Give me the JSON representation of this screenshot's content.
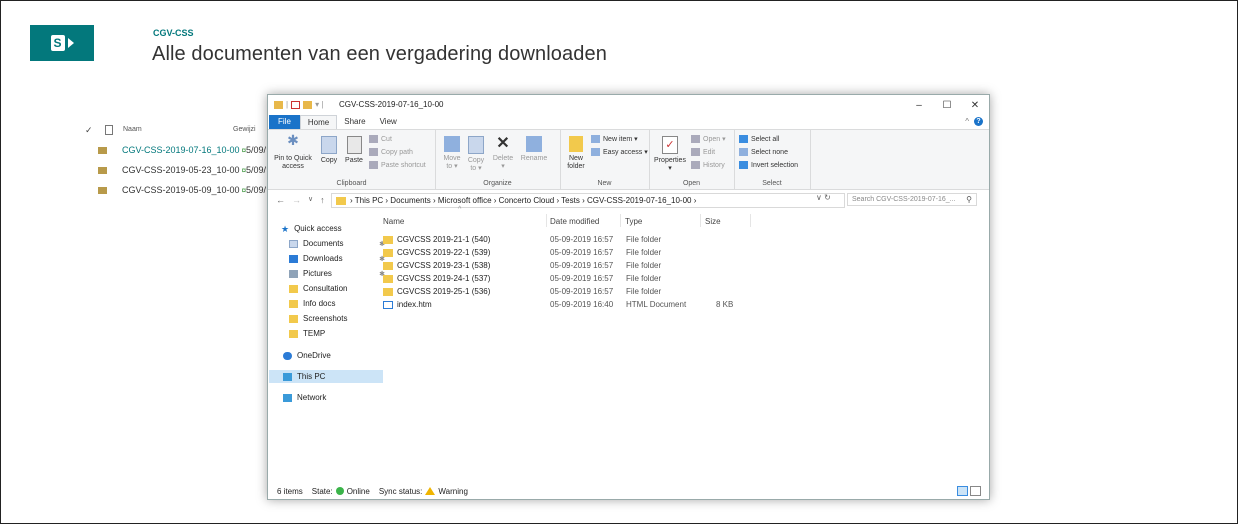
{
  "sharepoint": {
    "site_name": "CGV-CSS",
    "page_title": "Alle documenten van een vergadering downloaden",
    "accent_color": "#03787c",
    "list": {
      "check_glyph": "✓",
      "col_name": "Naam",
      "col_modified": "Gewijzi",
      "rows": [
        {
          "name": "CGV-CSS-2019-07-16_10-00",
          "new_marker": "¤",
          "date": "5/09/"
        },
        {
          "name": "CGV-CSS-2019-05-23_10-00",
          "new_marker": "¤",
          "date": "5/09/"
        },
        {
          "name": "CGV-CSS-2019-05-09_10-00",
          "new_marker": "¤",
          "date": "5/09/"
        }
      ]
    }
  },
  "explorer": {
    "title": "CGV-CSS-2019-07-16_10-00",
    "qa_dropdown": "▾ |",
    "window_controls": {
      "minimize": "–",
      "maximize": "☐",
      "close": "✕"
    },
    "tabs": {
      "file": "File",
      "home": "Home",
      "share": "Share",
      "view": "View"
    },
    "ribbon_collapse": "^",
    "help": "?",
    "clipboard": {
      "pin_to_quick_access": "Pin to Quick access",
      "copy": "Copy",
      "paste": "Paste",
      "cut": "Cut",
      "copy_path": "Copy path",
      "paste_shortcut": "Paste shortcut",
      "label": "Clipboard"
    },
    "organize": {
      "move_to": "Move to ▾",
      "copy_to": "Copy to ▾",
      "delete": "Delete ▾",
      "rename": "Rename",
      "label": "Organize"
    },
    "new": {
      "new_item": "New item ▾",
      "easy_access": "Easy access ▾",
      "new_folder": "New folder",
      "label": "New"
    },
    "open": {
      "properties": "Properties ▾",
      "open": "Open ▾",
      "edit": "Edit",
      "history": "History",
      "label": "Open"
    },
    "select": {
      "select_all": "Select all",
      "select_none": "Select none",
      "invert_selection": "Invert selection",
      "label": "Select"
    },
    "address": {
      "back": "←",
      "forward": "→",
      "recent": "∨",
      "up": "↑",
      "path": "› This PC › Documents › Microsoft office › Concerto Cloud › Tests › CGV-CSS-2019-07-16_10-00 ›",
      "controls": "∨ ↻",
      "search_placeholder": "Search CGV-CSS-2019-07-16_...",
      "search_glyph": "⚲"
    },
    "nav_pane": {
      "quick_access": "Quick access",
      "items": [
        {
          "label": "Documents",
          "pinned": true
        },
        {
          "label": "Downloads",
          "pinned": true
        },
        {
          "label": "Pictures",
          "pinned": true
        },
        {
          "label": "Consultation",
          "pinned": false
        },
        {
          "label": "Info docs",
          "pinned": false
        },
        {
          "label": "Screenshots",
          "pinned": false
        },
        {
          "label": "TEMP",
          "pinned": false
        }
      ],
      "pin_glyph": "✱",
      "onedrive": "OneDrive",
      "this_pc": "This PC",
      "network": "Network"
    },
    "columns": {
      "sort_caret": "^",
      "name": "Name",
      "date_modified": "Date modified",
      "type": "Type",
      "size": "Size"
    },
    "files": [
      {
        "name": "CGVCSS 2019-21-1 (540)",
        "date": "05-09-2019 16:57",
        "type": "File folder",
        "size": ""
      },
      {
        "name": "CGVCSS 2019-22-1 (539)",
        "date": "05-09-2019 16:57",
        "type": "File folder",
        "size": ""
      },
      {
        "name": "CGVCSS 2019-23-1 (538)",
        "date": "05-09-2019 16:57",
        "type": "File folder",
        "size": ""
      },
      {
        "name": "CGVCSS 2019-24-1 (537)",
        "date": "05-09-2019 16:57",
        "type": "File folder",
        "size": ""
      },
      {
        "name": "CGVCSS 2019-25-1 (536)",
        "date": "05-09-2019 16:57",
        "type": "File folder",
        "size": ""
      },
      {
        "name": "index.htm",
        "date": "05-09-2019 16:40",
        "type": "HTML Document",
        "size": "8 KB"
      }
    ],
    "status": {
      "items": "6 items",
      "state_label": "State:",
      "state_value": "Online",
      "sync_label": "Sync status:",
      "sync_value": "Warning"
    }
  }
}
